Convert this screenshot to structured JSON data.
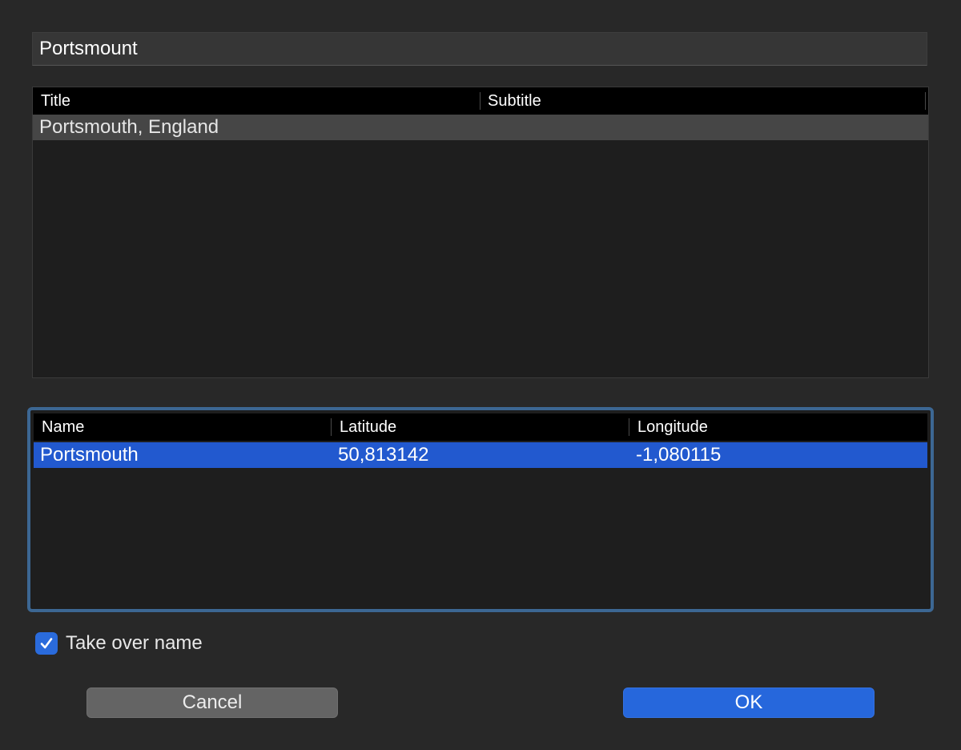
{
  "search": {
    "value": "Portsmount"
  },
  "results_table": {
    "columns": [
      "Title",
      "Subtitle"
    ],
    "rows": [
      {
        "title": "Portsmouth, England",
        "subtitle": ""
      }
    ]
  },
  "coords_table": {
    "columns": [
      "Name",
      "Latitude",
      "Longitude"
    ],
    "rows": [
      {
        "name": "Portsmouth",
        "latitude": "50,813142",
        "longitude": "-1,080115"
      }
    ]
  },
  "take_over_name": {
    "label": "Take over name",
    "checked": true
  },
  "buttons": {
    "cancel": "Cancel",
    "ok": "OK"
  },
  "colors": {
    "accent": "#2667dc",
    "selection": "#2259cf",
    "focus_ring": "#3c6793"
  }
}
